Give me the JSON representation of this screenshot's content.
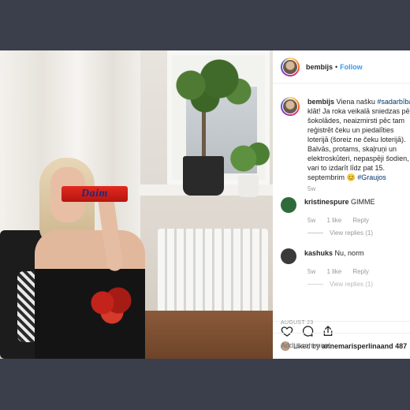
{
  "post": {
    "username": "bembijs",
    "follow_label": "Follow",
    "separator": "•"
  },
  "caption": {
    "username": "bembijs",
    "text_before_tag": "Viena našku ",
    "tag1": "#sadarbība",
    "text_after_tag": " klāt! Ja roka veikalā sniedzas pēc šokolādes, neaizmirsti pēc tam reģistrēt čeku un piedalīties loterijā (šoreiz ne čeku loterijā). Balvās, protams, skaļruņi un elektroskūteri, nepaspēji šodien, vari to izdarīt līdz pat 15. septembrim 😊 ",
    "tag2": "#Graujos",
    "age": "5w"
  },
  "comments": [
    {
      "username": "kristinespure",
      "text": "GIMME",
      "age": "5w",
      "likes": "1 like",
      "reply": "Reply",
      "view_replies": "View replies (1)",
      "avatar_color": "#2f6b3a"
    },
    {
      "username": "kashuks",
      "text": "Nu, norm",
      "age": "5w",
      "likes": "1 like",
      "reply": "Reply",
      "view_replies": "View replies (1)",
      "avatar_color": "#3a3a3a"
    }
  ],
  "liked_by": {
    "prefix": "Liked by ",
    "user": "annemarisperlina",
    "suffix": " and 487"
  },
  "date": "AUGUST 23",
  "add_comment_placeholder": "Add a comment...",
  "photo": {
    "candy_label": "Daim"
  },
  "icons": [
    "heart-icon",
    "comment-icon",
    "share-icon"
  ],
  "colors": {
    "follow": "#3897f0",
    "hashtag": "#003569",
    "meta": "#999999",
    "backdrop": "#3b3f4c"
  }
}
